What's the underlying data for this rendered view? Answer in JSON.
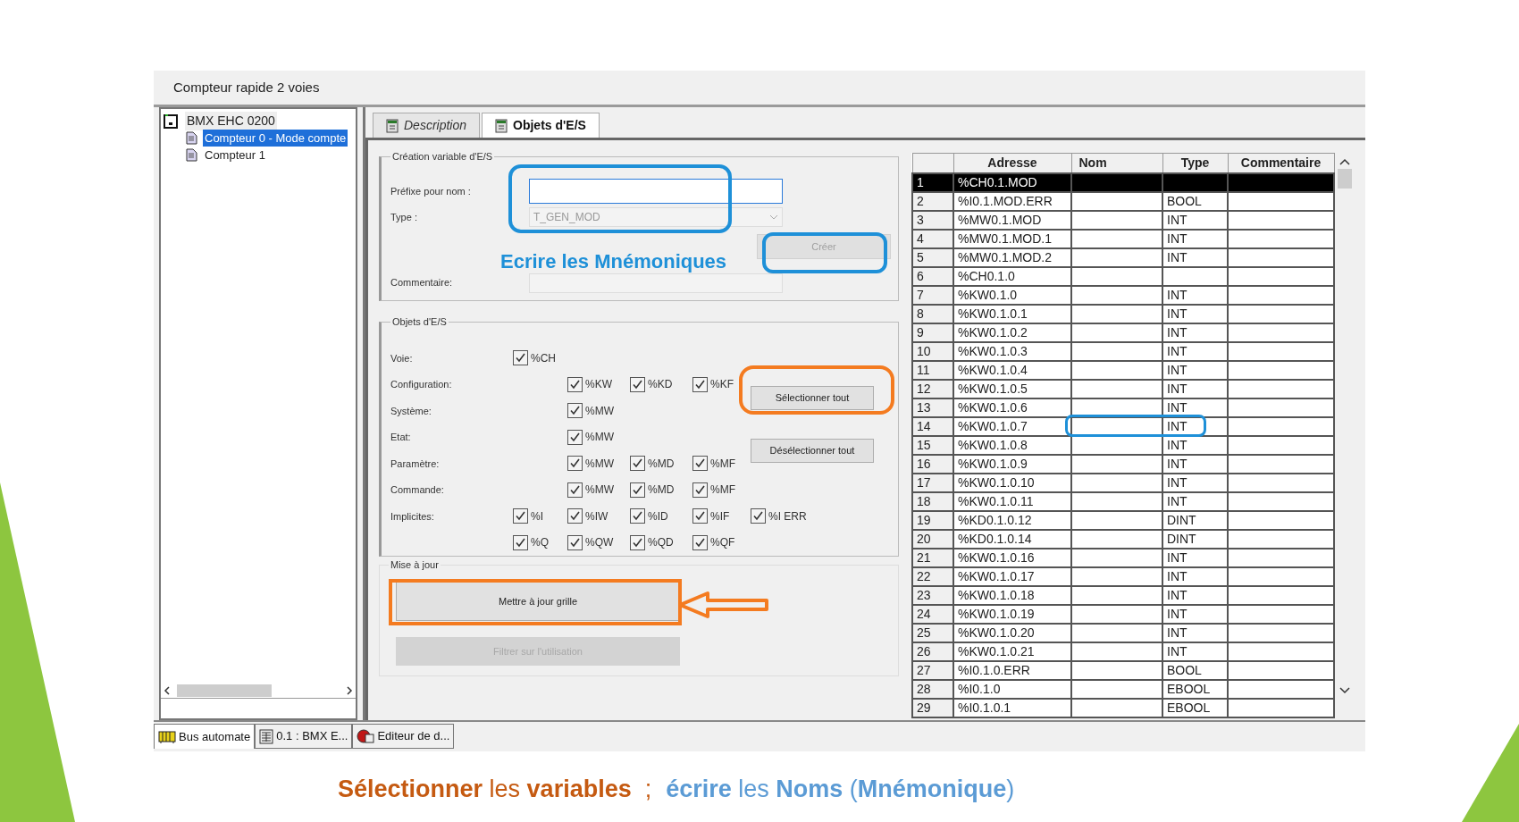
{
  "window": {
    "title": "Compteur rapide 2 voies"
  },
  "tree": {
    "root": {
      "label": "BMX EHC 0200",
      "children": [
        {
          "label": "Compteur 0 - Mode compte",
          "selected": true
        },
        {
          "label": "Compteur 1",
          "selected": false
        }
      ]
    }
  },
  "tabs": [
    {
      "label": "Description",
      "selected": false
    },
    {
      "label": "Objets d'E/S",
      "selected": true
    }
  ],
  "creation": {
    "title": "Création variable d'E/S",
    "prefix_label": "Préfixe pour nom :",
    "type_label": "Type :",
    "type_value": "T_GEN_MOD",
    "create_button": {
      "label": "Créer",
      "disabled": true
    },
    "comment_label": "Commentaire:"
  },
  "objects": {
    "title": "Objets d'E/S",
    "rows": [
      {
        "label": "Voie:",
        "cells": [
          {
            "label": "%CH",
            "checked": true
          },
          null,
          null,
          null,
          null
        ]
      },
      {
        "label": "Configuration:",
        "cells": [
          null,
          {
            "label": "%KW",
            "checked": true
          },
          {
            "label": "%KD",
            "checked": true
          },
          {
            "label": "%KF",
            "checked": true
          },
          null
        ]
      },
      {
        "label": "Système:",
        "cells": [
          null,
          {
            "label": "%MW",
            "checked": true
          },
          null,
          null,
          null
        ]
      },
      {
        "label": "Etat:",
        "cells": [
          null,
          {
            "label": "%MW",
            "checked": true
          },
          null,
          null,
          null
        ]
      },
      {
        "label": "Paramètre:",
        "cells": [
          null,
          {
            "label": "%MW",
            "checked": true
          },
          {
            "label": "%MD",
            "checked": true
          },
          {
            "label": "%MF",
            "checked": true
          },
          null
        ]
      },
      {
        "label": "Commande:",
        "cells": [
          null,
          {
            "label": "%MW",
            "checked": true
          },
          {
            "label": "%MD",
            "checked": true
          },
          {
            "label": "%MF",
            "checked": true
          },
          null
        ]
      },
      {
        "label": "Implicites:",
        "cells": [
          {
            "label": "%I",
            "checked": true
          },
          {
            "label": "%IW",
            "checked": true
          },
          {
            "label": "%ID",
            "checked": true
          },
          {
            "label": "%IF",
            "checked": true
          },
          {
            "label": "%I ERR",
            "checked": true
          }
        ]
      },
      {
        "label": "",
        "cells": [
          {
            "label": "%Q",
            "checked": true
          },
          {
            "label": "%QW",
            "checked": true
          },
          {
            "label": "%QD",
            "checked": true
          },
          {
            "label": "%QF",
            "checked": true
          },
          null
        ]
      }
    ],
    "buttons": [
      {
        "label": "Sélectionner tout"
      },
      {
        "label": "Désélectionner tout"
      }
    ]
  },
  "update": {
    "title": "Mise à jour",
    "buttons": [
      {
        "label": "Mettre à jour grille",
        "disabled": false
      },
      {
        "label": "Filtrer sur l'utilisation",
        "disabled": true
      }
    ]
  },
  "note": "Ecrire les Mnémoniques",
  "table": {
    "columns": [
      "Adresse",
      "Nom",
      "Type",
      "Commentaire"
    ],
    "rows": [
      {
        "n": "1",
        "address": "%CH0.1.MOD",
        "type": "",
        "selected": true
      },
      {
        "n": "2",
        "address": "%I0.1.MOD.ERR",
        "type": "BOOL",
        "selected": false
      },
      {
        "n": "3",
        "address": "%MW0.1.MOD",
        "type": "INT",
        "selected": false
      },
      {
        "n": "4",
        "address": "%MW0.1.MOD.1",
        "type": "INT",
        "selected": false
      },
      {
        "n": "5",
        "address": "%MW0.1.MOD.2",
        "type": "INT",
        "selected": false
      },
      {
        "n": "6",
        "address": "%CH0.1.0",
        "type": "",
        "selected": false
      },
      {
        "n": "7",
        "address": "%KW0.1.0",
        "type": "INT",
        "selected": false
      },
      {
        "n": "8",
        "address": "%KW0.1.0.1",
        "type": "INT",
        "selected": false
      },
      {
        "n": "9",
        "address": "%KW0.1.0.2",
        "type": "INT",
        "selected": false
      },
      {
        "n": "10",
        "address": "%KW0.1.0.3",
        "type": "INT",
        "selected": false
      },
      {
        "n": "11",
        "address": "%KW0.1.0.4",
        "type": "INT",
        "selected": false
      },
      {
        "n": "12",
        "address": "%KW0.1.0.5",
        "type": "INT",
        "selected": false
      },
      {
        "n": "13",
        "address": "%KW0.1.0.6",
        "type": "INT",
        "selected": false
      },
      {
        "n": "14",
        "address": "%KW0.1.0.7",
        "type": "INT",
        "selected": false
      },
      {
        "n": "15",
        "address": "%KW0.1.0.8",
        "type": "INT",
        "selected": false
      },
      {
        "n": "16",
        "address": "%KW0.1.0.9",
        "type": "INT",
        "selected": false
      },
      {
        "n": "17",
        "address": "%KW0.1.0.10",
        "type": "INT",
        "selected": false
      },
      {
        "n": "18",
        "address": "%KW0.1.0.11",
        "type": "INT",
        "selected": false
      },
      {
        "n": "19",
        "address": "%KD0.1.0.12",
        "type": "DINT",
        "selected": false
      },
      {
        "n": "20",
        "address": "%KD0.1.0.14",
        "type": "DINT",
        "selected": false
      },
      {
        "n": "21",
        "address": "%KW0.1.0.16",
        "type": "INT",
        "selected": false
      },
      {
        "n": "22",
        "address": "%KW0.1.0.17",
        "type": "INT",
        "selected": false
      },
      {
        "n": "23",
        "address": "%KW0.1.0.18",
        "type": "INT",
        "selected": false
      },
      {
        "n": "24",
        "address": "%KW0.1.0.19",
        "type": "INT",
        "selected": false
      },
      {
        "n": "25",
        "address": "%KW0.1.0.20",
        "type": "INT",
        "selected": false
      },
      {
        "n": "26",
        "address": "%KW0.1.0.21",
        "type": "INT",
        "selected": false
      },
      {
        "n": "27",
        "address": "%I0.1.0.ERR",
        "type": "BOOL",
        "selected": false
      },
      {
        "n": "28",
        "address": "%I0.1.0",
        "type": "EBOOL",
        "selected": false
      },
      {
        "n": "29",
        "address": "%I0.1.0.1",
        "type": "EBOOL",
        "selected": false
      }
    ]
  },
  "taskbar": [
    {
      "label": "Bus automate",
      "kind": "bus",
      "selected": true
    },
    {
      "label": "0.1 : BMX E...",
      "kind": "module",
      "selected": false
    },
    {
      "label": "Editeur de d...",
      "kind": "editor",
      "selected": false
    }
  ],
  "caption": [
    {
      "text": "**Sélectionner** les **variables**  ;",
      "color": "#c55a11"
    },
    {
      "text": "**écrire** les **Noms** (**Mnémonique**)",
      "color": "#5b9bd5"
    }
  ]
}
